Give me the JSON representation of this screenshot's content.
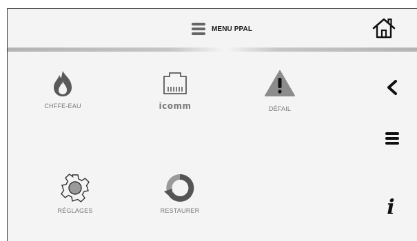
{
  "header": {
    "title": "MENU PPAL",
    "menu_icon": "hamburger-menu-icon",
    "home_icon": "house-icon"
  },
  "tiles": [
    {
      "label": "CHFFE-EAU",
      "icon": "flame-icon"
    },
    {
      "label": "icomm",
      "icon": "network-port-icon"
    },
    {
      "label": "DÉFAIL",
      "icon": "warning-triangle-icon"
    },
    {
      "label": "RÉGLAGES",
      "icon": "gear-icon"
    },
    {
      "label": "RESTAURER",
      "icon": "restore-arrow-icon"
    }
  ],
  "side": {
    "back_icon": "chevron-left-icon",
    "menu_icon": "hamburger-menu-icon",
    "info_icon": "info-icon",
    "info_glyph": "i"
  },
  "colors": {
    "frame_bg": "#f4f4f4",
    "icon_gray": "#5a5a5a",
    "label_gray": "#7a7a7a",
    "divider": "#b3b3b3"
  }
}
